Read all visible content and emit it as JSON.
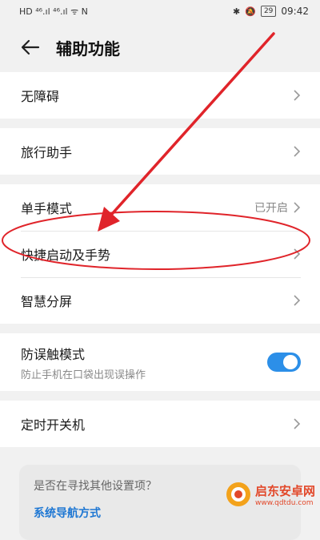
{
  "status_bar": {
    "left_text": "HD  ⁴⁶.ıl ⁴⁶.ıl  ᯤ N",
    "battery": "29",
    "time": "09:42"
  },
  "header": {
    "title": "辅助功能"
  },
  "groups": {
    "g1": {
      "label": "无障碍"
    },
    "g2": {
      "label": "旅行助手"
    },
    "g3": {
      "one_hand": {
        "label": "单手模式",
        "value": "已开启"
      },
      "gestures": {
        "label": "快捷启动及手势"
      },
      "split": {
        "label": "智慧分屏"
      }
    },
    "g4": {
      "label": "防误触模式",
      "sub": "防止手机在口袋出现误操作",
      "toggle_on": true
    },
    "g5": {
      "label": "定时开关机"
    }
  },
  "suggest": {
    "question": "是否在寻找其他设置项？",
    "link": "系统导航方式"
  },
  "annotation": {
    "color": "#e0242a"
  },
  "watermark": {
    "name": "启东安卓网",
    "url": "www.qdtdu.com"
  }
}
